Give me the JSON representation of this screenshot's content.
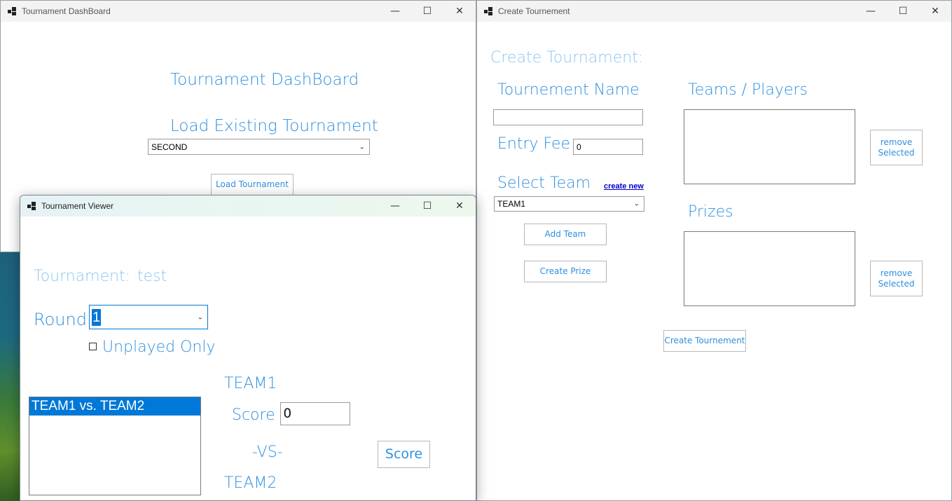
{
  "dashboard": {
    "window_title": "Tournament DashBoard",
    "heading": "Tournament DashBoard",
    "load_label": "Load Existing Tournament",
    "tournament_select": "SECOND",
    "load_button": "Load Tournament"
  },
  "viewer": {
    "window_title": "Tournament Viewer",
    "tournament_label": "Tournament:",
    "tournament_name": "test",
    "round_label": "Round",
    "round_value": "1",
    "unplayed_label": "Unplayed Only",
    "matchups": [
      "TEAM1 vs. TEAM2"
    ],
    "team_one": "TEAM1",
    "team_one_score_label": "Score",
    "team_one_score": "0",
    "vs_label": "-VS-",
    "team_two": "TEAM2",
    "score_button": "Score"
  },
  "create": {
    "window_title": "Create Tournement",
    "heading": "Create Tournament:",
    "name_label": "Tournement Name",
    "name_value": "",
    "entry_fee_label": "Entry Fee",
    "entry_fee_value": "0",
    "select_team_label": "Select Team",
    "create_new_link": "create new",
    "team_select": "TEAM1",
    "add_team_button": "Add Team",
    "create_prize_button": "Create Prize",
    "teams_label": "Teams / Players",
    "prizes_label": "Prizes",
    "remove_selected_1": "remove Selected",
    "remove_selected_2": "remove Selected",
    "create_button": "Create Tournement"
  },
  "icons": {
    "minimize": "minimize-icon",
    "maximize": "maximize-icon",
    "close": "close-icon",
    "app": "app-icon",
    "chevron": "chevron-down-icon"
  },
  "colors": {
    "label_blue": "#2f8fdf",
    "selection_blue": "#0078d7"
  }
}
